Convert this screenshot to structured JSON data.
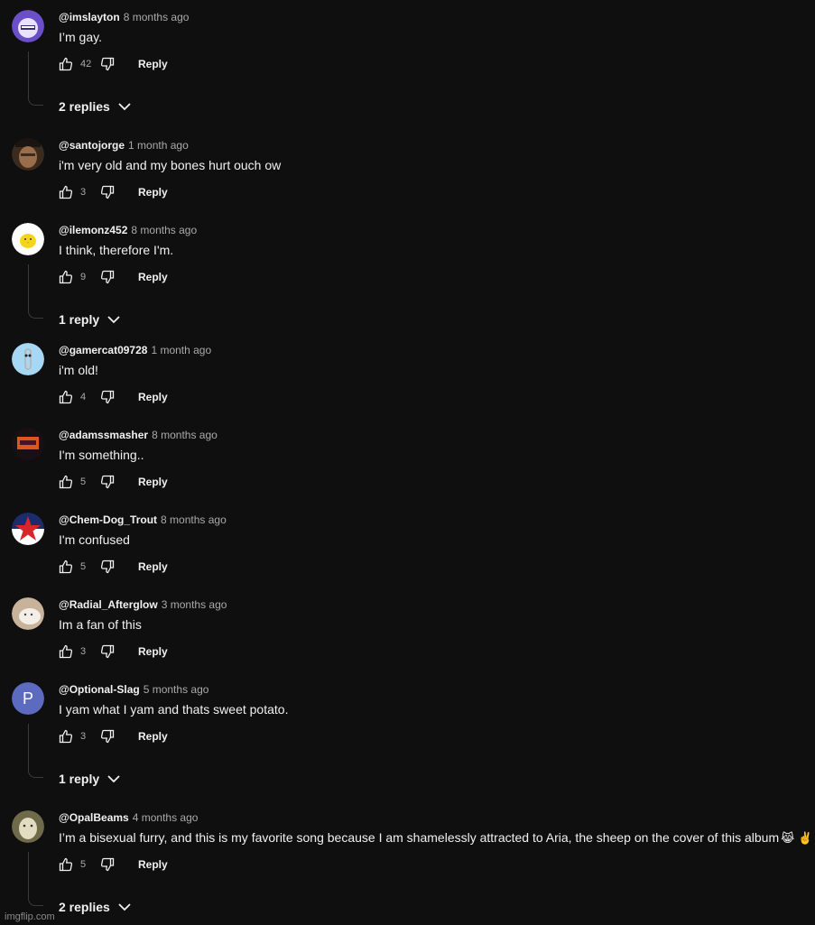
{
  "comments": [
    {
      "author": "@imslayton",
      "time": "8 months ago",
      "text": "I’m gay.",
      "likes": "42",
      "reply_label": "Reply",
      "replies_label": "2 replies",
      "avatar_colors": [
        "#6b4fc9",
        "#e9e2ff"
      ]
    },
    {
      "author": "@santojorge",
      "time": "1 month ago",
      "text": "i'm very old and my bones hurt ouch ow",
      "likes": "3",
      "reply_label": "Reply",
      "replies_label": "",
      "avatar_colors": [
        "#3b2a1e",
        "#9a6d4b"
      ]
    },
    {
      "author": "@ilemonz452",
      "time": "8 months ago",
      "text": "I think, therefore I'm.",
      "likes": "9",
      "reply_label": "Reply",
      "replies_label": "1 reply",
      "avatar_colors": [
        "#ffffff",
        "#f5d51c"
      ]
    },
    {
      "author": "@gamercat09728",
      "time": "1 month ago",
      "text": "i'm old!",
      "likes": "4",
      "reply_label": "Reply",
      "replies_label": "",
      "avatar_colors": [
        "#a6d8f5",
        "#b8b8b8"
      ]
    },
    {
      "author": "@adamssmasher",
      "time": "8 months ago",
      "text": "I'm something..",
      "likes": "5",
      "reply_label": "Reply",
      "replies_label": "",
      "avatar_colors": [
        "#1b0f16",
        "#e0551e"
      ]
    },
    {
      "author": "@Chem-Dog_Trout",
      "time": "8 months ago",
      "text": "I'm confused",
      "likes": "5",
      "reply_label": "Reply",
      "replies_label": "",
      "avatar_colors": [
        "#1c2b6b",
        "#d6262b"
      ]
    },
    {
      "author": "@Radial_Afterglow",
      "time": "3 months ago",
      "text": "Im a fan of this",
      "likes": "3",
      "reply_label": "Reply",
      "replies_label": "",
      "avatar_colors": [
        "#c8b39a",
        "#f3efe8"
      ]
    },
    {
      "author": "@Optional-Slag",
      "time": "5 months ago",
      "text": "I yam what I yam and thats sweet potato.",
      "likes": "3",
      "reply_label": "Reply",
      "replies_label": "1 reply",
      "avatar_colors": [
        "#5c6bc0",
        "#ffffff"
      ],
      "avatar_letter": "P"
    },
    {
      "author": "@OpalBeams",
      "time": "4 months ago",
      "text": "I’m a bisexual furry, and this is my favorite song because I am shamelessly attracted to Aria, the sheep on the cover of this album",
      "emoji": "😹 ✌️",
      "likes": "5",
      "reply_label": "Reply",
      "replies_label": "2 replies",
      "avatar_colors": [
        "#6e6a4a",
        "#e2dcc0"
      ]
    }
  ],
  "watermark": "imgflip.com"
}
